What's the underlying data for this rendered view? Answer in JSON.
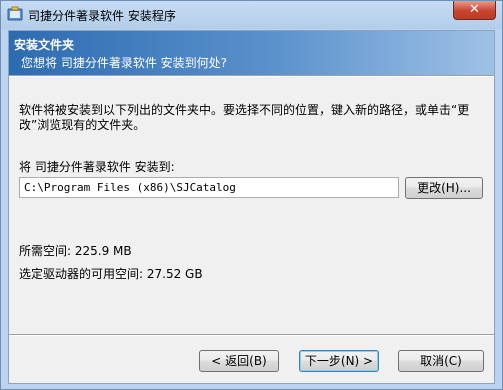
{
  "window": {
    "title": "司捷分件著录软件 安装程序",
    "close_glyph": "✕"
  },
  "header": {
    "title": "安装文件夹",
    "subtitle": "您想将 司捷分件著录软件 安装到何处?"
  },
  "main": {
    "description": "软件将被安装到以下列出的文件夹中。要选择不同的位置，键入新的路径，或单击“更改”浏览现有的文件夹。",
    "folder_label": "将 司捷分件著录软件 安装到:",
    "folder_path": "C:\\Program Files (x86)\\SJCatalog",
    "browse_label": "更改(H)...",
    "space_required": "所需空间: 225.9 MB",
    "space_available": "选定驱动器的可用空间: 27.52 GB"
  },
  "buttons": {
    "back": "< 返回(B)",
    "next": "下一步(N) >",
    "cancel": "取消(C)"
  }
}
